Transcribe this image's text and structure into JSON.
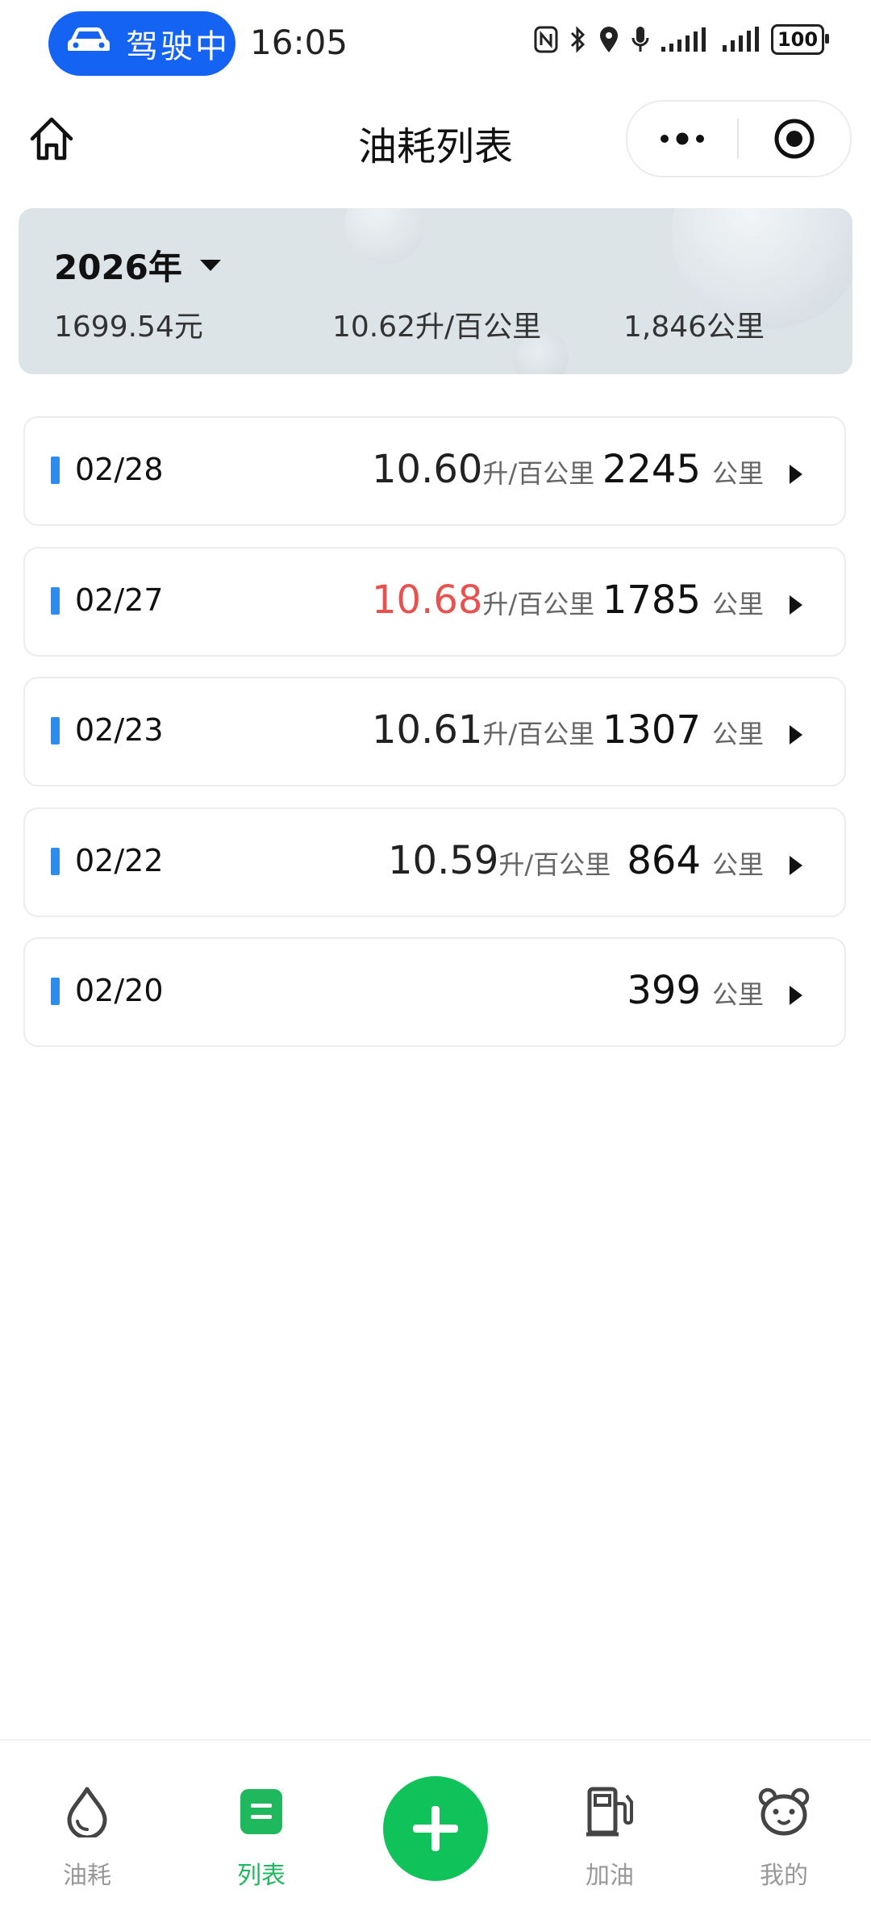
{
  "status_bar": {
    "driving_label": "驾驶中",
    "time": "16:05",
    "battery": "100"
  },
  "nav": {
    "title": "油耗列表"
  },
  "summary": {
    "year": "2026年",
    "total_cost": "1699.54元",
    "avg_consumption": "10.62升/百公里",
    "total_distance": "1,846公里"
  },
  "records": [
    {
      "date": "02/28",
      "consumption": "10.60",
      "consumption_unit": "升/百公里",
      "distance": "2245",
      "distance_unit": "公里",
      "highlight": false
    },
    {
      "date": "02/27",
      "consumption": "10.68",
      "consumption_unit": "升/百公里",
      "distance": "1785",
      "distance_unit": "公里",
      "highlight": true
    },
    {
      "date": "02/23",
      "consumption": "10.61",
      "consumption_unit": "升/百公里",
      "distance": "1307",
      "distance_unit": "公里",
      "highlight": false
    },
    {
      "date": "02/22",
      "consumption": "10.59",
      "consumption_unit": "升/百公里",
      "distance": "864",
      "distance_unit": "公里",
      "highlight": false
    },
    {
      "date": "02/20",
      "consumption": "",
      "consumption_unit": "",
      "distance": "399",
      "distance_unit": "公里",
      "highlight": false
    }
  ],
  "tabs": {
    "fuel": "油耗",
    "list": "列表",
    "refuel": "加油",
    "mine": "我的"
  },
  "colors": {
    "accent_green": "#10c25a",
    "drive_blue": "#1463f3",
    "record_bar_blue": "#2a8ef0",
    "high_consumption_red": "#e8514e"
  }
}
